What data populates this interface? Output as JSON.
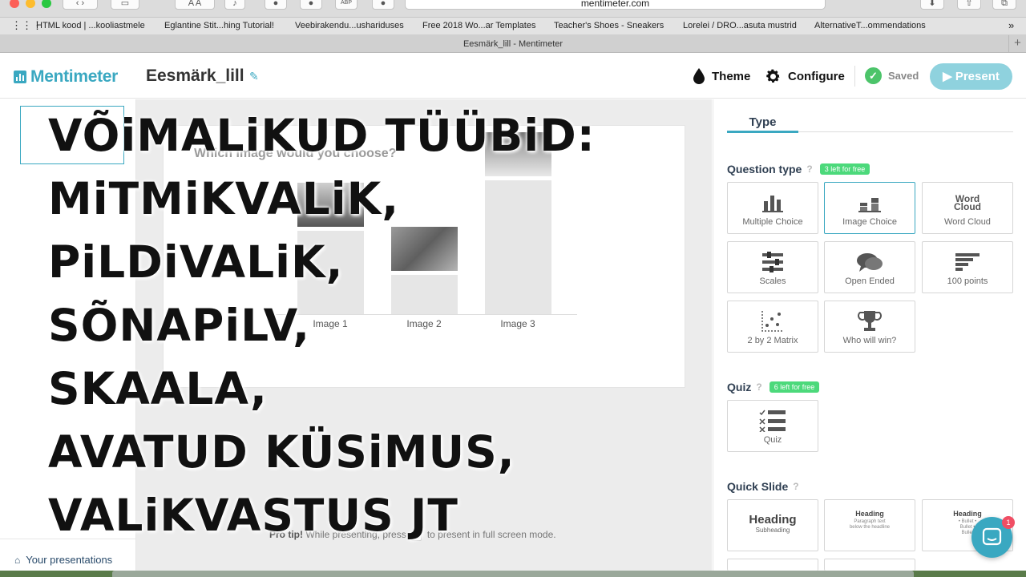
{
  "browser": {
    "url": "mentimeter.com",
    "font_small": "A",
    "font_large": "A",
    "adblock_label": "ABP",
    "tab_title": "Eesmärk_lill - Mentimeter",
    "bookmarks": [
      "HTML kood | ...kooliastmele",
      "Eglantine Stit...hing Tutorial!",
      "Veebirakendu...ushariduses",
      "Free 2018 Wo...ar Templates",
      "Teacher's Shoes - Sneakers",
      "Lorelei / DRO...asuta mustrid",
      "AlternativeT...ommendations"
    ],
    "more": "»",
    "new_tab": "+"
  },
  "header": {
    "logo": "Mentimeter",
    "title": "Eesmärk_lill",
    "theme": "Theme",
    "configure": "Configure",
    "saved": "Saved",
    "present": "Present"
  },
  "left": {
    "your_presentations": "Your presentations"
  },
  "slide": {
    "question": "Which image would you choose?",
    "bars": [
      {
        "label": "Image 1",
        "value": 0.58
      },
      {
        "label": "Image 2",
        "value": 0.27
      },
      {
        "label": "Image 3",
        "value": 0.93
      }
    ]
  },
  "protip": {
    "bold": "Pro tip!",
    "before": " While presenting, press ",
    "key": "F",
    "after": " to present in full screen mode."
  },
  "right": {
    "tab": "Type",
    "question_type": {
      "title": "Question type",
      "badge": "3 left for free",
      "items": [
        {
          "label": "Multiple Choice"
        },
        {
          "label": "Image Choice"
        },
        {
          "label": "Word Cloud"
        },
        {
          "label": "Scales"
        },
        {
          "label": "Open Ended"
        },
        {
          "label": "100 points"
        },
        {
          "label": "2 by 2 Matrix"
        },
        {
          "label": "Who will win?"
        }
      ]
    },
    "quiz": {
      "title": "Quiz",
      "badge": "6 left for free",
      "item": "Quiz"
    },
    "quick_slide": {
      "title": "Quick Slide",
      "items": [
        {
          "heading": "Heading",
          "sub": "Subheading"
        },
        {
          "heading": "Heading",
          "sub": "Paragraph text below the headline"
        },
        {
          "heading": "Heading",
          "sub": "• Bullet • Bullet • Bullet"
        }
      ]
    },
    "wordcloud_icon_text": "Word Cloud"
  },
  "chat_badge": "1",
  "overlay_lines": [
    "VÕiMALiKUD TÜÜBiD:",
    "MiTMiKVALiK,",
    "PiLDiVALiK,",
    "SÕNAPiLV,",
    "SKAALA,",
    "AVATUD KÜSiMUS,",
    "VALiKVASTUS JT"
  ],
  "colors": {
    "accent": "#3aa8c1",
    "saved_green": "#4cc46a",
    "badge_green": "#4cd97b",
    "present_bg": "#8fd2de"
  }
}
